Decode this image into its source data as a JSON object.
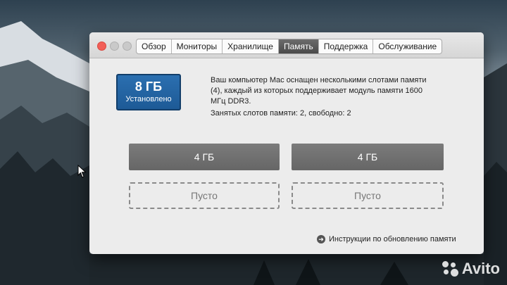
{
  "window": {
    "tabs": [
      {
        "label": "Обзор"
      },
      {
        "label": "Мониторы"
      },
      {
        "label": "Хранилище"
      },
      {
        "label": "Память"
      },
      {
        "label": "Поддержка"
      },
      {
        "label": "Обслуживание"
      }
    ],
    "active_tab": "Память"
  },
  "memory": {
    "size": "8 ГБ",
    "status": "Установлено",
    "description": "Ваш компьютер Mac оснащен несколькими слотами памяти (4), каждый из которых поддерживает модуль памяти 1600 МГц DDR3.",
    "slots_info": "Занятых слотов памяти: 2, свободно: 2",
    "slots": [
      {
        "label": "4 ГБ"
      },
      {
        "label": "4 ГБ"
      },
      {
        "label": "Пусто"
      },
      {
        "label": "Пусто"
      }
    ],
    "upgrade_link": "Инструкции по обновлению памяти"
  },
  "watermark": {
    "text": "Avito"
  },
  "colors": {
    "badge": "#2b6fb0",
    "slot_filled": "#6f6f6f",
    "active_tab": "#555555",
    "close_button": "#f25f58"
  }
}
